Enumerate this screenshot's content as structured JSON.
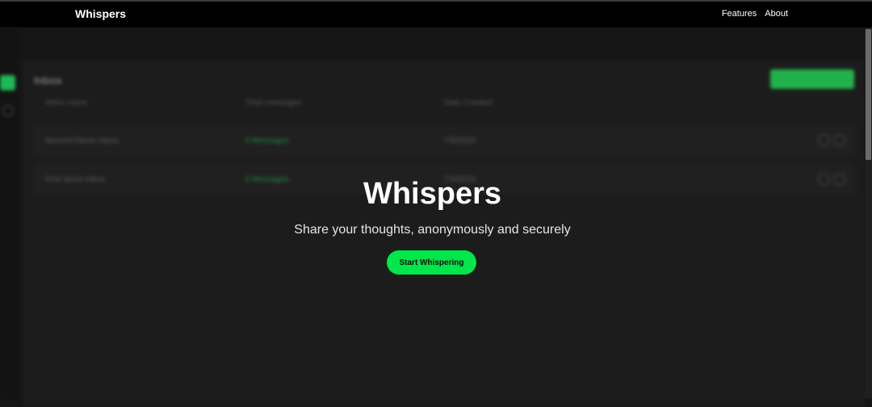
{
  "nav": {
    "brand": "Whispers",
    "links": [
      "Features",
      "About"
    ]
  },
  "background_app": {
    "title": "Inbox",
    "headers": [
      "Inbox name",
      "Total messages",
      "Date Created"
    ],
    "rows": [
      {
        "name": "Second Demo Inbox",
        "messages": "0 Messages",
        "date": "7/5/2024"
      },
      {
        "name": "First demo inbox",
        "messages": "0 Messages",
        "date": "7/5/2024"
      }
    ]
  },
  "hero": {
    "title": "Whispers",
    "subtitle": "Share your thoughts, anonymously and securely",
    "cta_label": "Start Whispering"
  },
  "colors": {
    "accent": "#00e64b",
    "background": "#151515",
    "nav": "#000000"
  }
}
